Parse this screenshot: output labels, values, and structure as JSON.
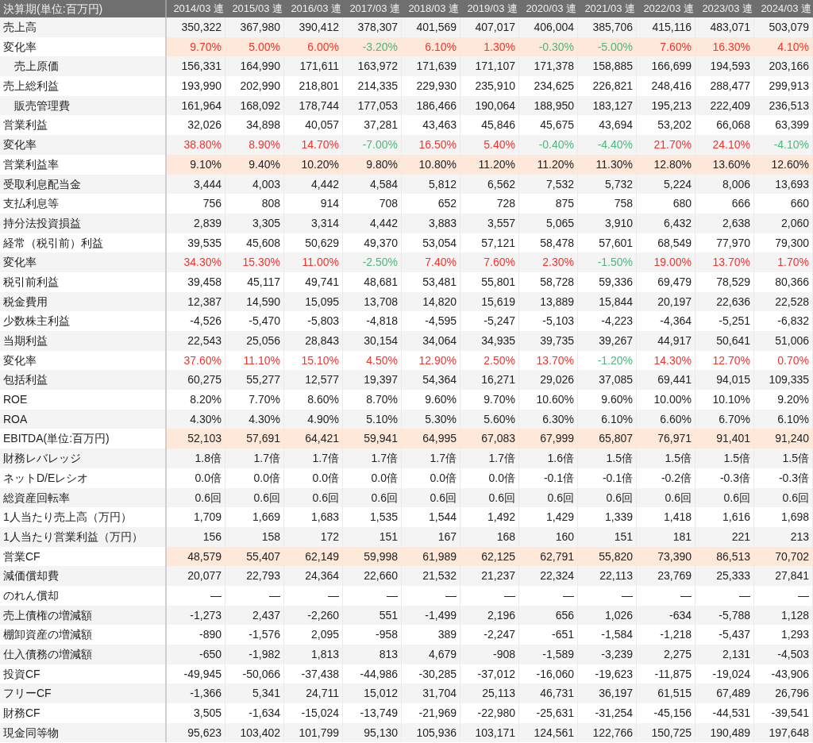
{
  "table": {
    "corner": "決算期(単位:百万円)",
    "columns": [
      "2014/03 連",
      "2015/03 連",
      "2016/03 連",
      "2017/03 連",
      "2018/03 連",
      "2019/03 連",
      "2020/03 連",
      "2021/03 連",
      "2022/03 連",
      "2023/03 連",
      "2024/03 連"
    ],
    "rows": [
      {
        "label": "売上高",
        "kind": "item",
        "highlighted": false,
        "cells": [
          "350,322",
          "367,980",
          "390,412",
          "378,307",
          "401,569",
          "407,017",
          "406,004",
          "385,706",
          "415,116",
          "483,071",
          "503,079"
        ]
      },
      {
        "label": "変化率",
        "kind": "rate",
        "highlighted": true,
        "cells": [
          {
            "text": "9.70%",
            "color": "#f5332b"
          },
          {
            "text": "5.00%",
            "color": "#f5332b"
          },
          {
            "text": "6.00%",
            "color": "#f5332b"
          },
          {
            "text": "-3.20%",
            "color": "#4cb87a"
          },
          {
            "text": "6.10%",
            "color": "#f5332b"
          },
          {
            "text": "1.30%",
            "color": "#f5332b"
          },
          {
            "text": "-0.30%",
            "color": "#4cb87a"
          },
          {
            "text": "-5.00%",
            "color": "#4cb87a"
          },
          {
            "text": "7.60%",
            "color": "#f5332b"
          },
          {
            "text": "16.30%",
            "color": "#f5332b"
          },
          {
            "text": "4.10%",
            "color": "#f5332b"
          }
        ]
      },
      {
        "label": "売上原価",
        "kind": "sub",
        "highlighted": false,
        "cells": [
          "156,331",
          "164,990",
          "171,611",
          "163,972",
          "171,639",
          "171,107",
          "171,378",
          "158,885",
          "166,699",
          "194,593",
          "203,166"
        ]
      },
      {
        "label": "売上総利益",
        "kind": "item",
        "highlighted": false,
        "cells": [
          "193,990",
          "202,990",
          "218,801",
          "214,335",
          "229,930",
          "235,910",
          "234,625",
          "226,821",
          "248,416",
          "288,477",
          "299,913"
        ]
      },
      {
        "label": "販売管理費",
        "kind": "sub",
        "highlighted": false,
        "cells": [
          "161,964",
          "168,092",
          "178,744",
          "177,053",
          "186,466",
          "190,064",
          "188,950",
          "183,127",
          "195,213",
          "222,409",
          "236,513"
        ]
      },
      {
        "label": "営業利益",
        "kind": "item",
        "highlighted": false,
        "cells": [
          "32,026",
          "34,898",
          "40,057",
          "37,281",
          "43,463",
          "45,846",
          "45,675",
          "43,694",
          "53,202",
          "66,068",
          "63,399"
        ]
      },
      {
        "label": "変化率",
        "kind": "rate",
        "highlighted": false,
        "cells": [
          {
            "text": "38.80%",
            "color": "#f5332b"
          },
          {
            "text": "8.90%",
            "color": "#f5332b"
          },
          {
            "text": "14.70%",
            "color": "#f5332b"
          },
          {
            "text": "-7.00%",
            "color": "#4cb87a"
          },
          {
            "text": "16.50%",
            "color": "#f5332b"
          },
          {
            "text": "5.40%",
            "color": "#f5332b"
          },
          {
            "text": "-0.40%",
            "color": "#4cb87a"
          },
          {
            "text": "-4.40%",
            "color": "#4cb87a"
          },
          {
            "text": "21.70%",
            "color": "#f5332b"
          },
          {
            "text": "24.10%",
            "color": "#f5332b"
          },
          {
            "text": "-4.10%",
            "color": "#4cb87a"
          }
        ]
      },
      {
        "label": "営業利益率",
        "kind": "item",
        "highlighted": true,
        "cells": [
          "9.10%",
          "9.40%",
          "10.20%",
          "9.80%",
          "10.80%",
          "11.20%",
          "11.20%",
          "11.30%",
          "12.80%",
          "13.60%",
          "12.60%"
        ]
      },
      {
        "label": "受取利息配当金",
        "kind": "item",
        "highlighted": false,
        "cells": [
          "3,444",
          "4,003",
          "4,442",
          "4,584",
          "5,812",
          "6,562",
          "7,532",
          "5,732",
          "5,224",
          "8,006",
          "13,693"
        ]
      },
      {
        "label": "支払利息等",
        "kind": "item",
        "highlighted": false,
        "cells": [
          "756",
          "808",
          "914",
          "708",
          "652",
          "728",
          "875",
          "758",
          "680",
          "666",
          "660"
        ]
      },
      {
        "label": "持分法投資損益",
        "kind": "item",
        "highlighted": false,
        "cells": [
          "2,839",
          "3,305",
          "3,314",
          "4,442",
          "3,883",
          "3,557",
          "5,065",
          "3,910",
          "6,432",
          "2,638",
          "2,060"
        ]
      },
      {
        "label": "経常（税引前）利益",
        "kind": "item",
        "highlighted": false,
        "cells": [
          "39,535",
          "45,608",
          "50,629",
          "49,370",
          "53,054",
          "57,121",
          "58,478",
          "57,601",
          "68,549",
          "77,970",
          "79,300"
        ]
      },
      {
        "label": "変化率",
        "kind": "rate",
        "highlighted": false,
        "cells": [
          {
            "text": "34.30%",
            "color": "#f5332b"
          },
          {
            "text": "15.30%",
            "color": "#f5332b"
          },
          {
            "text": "11.00%",
            "color": "#f5332b"
          },
          {
            "text": "-2.50%",
            "color": "#4cb87a"
          },
          {
            "text": "7.40%",
            "color": "#f5332b"
          },
          {
            "text": "7.60%",
            "color": "#f5332b"
          },
          {
            "text": "2.30%",
            "color": "#f5332b"
          },
          {
            "text": "-1.50%",
            "color": "#4cb87a"
          },
          {
            "text": "19.00%",
            "color": "#f5332b"
          },
          {
            "text": "13.70%",
            "color": "#f5332b"
          },
          {
            "text": "1.70%",
            "color": "#f5332b"
          }
        ]
      },
      {
        "label": "税引前利益",
        "kind": "item",
        "highlighted": false,
        "cells": [
          "39,458",
          "45,117",
          "49,741",
          "48,681",
          "53,481",
          "55,801",
          "58,728",
          "59,336",
          "69,479",
          "78,529",
          "80,366"
        ]
      },
      {
        "label": "税金費用",
        "kind": "item",
        "highlighted": false,
        "cells": [
          "12,387",
          "14,590",
          "15,095",
          "13,708",
          "14,820",
          "15,619",
          "13,889",
          "15,844",
          "20,197",
          "22,636",
          "22,528"
        ]
      },
      {
        "label": "少数株主利益",
        "kind": "item",
        "highlighted": false,
        "cells": [
          "-4,526",
          "-5,470",
          "-5,803",
          "-4,818",
          "-4,595",
          "-5,247",
          "-5,103",
          "-4,223",
          "-4,364",
          "-5,251",
          "-6,832"
        ]
      },
      {
        "label": "当期利益",
        "kind": "item",
        "highlighted": false,
        "cells": [
          "22,543",
          "25,056",
          "28,843",
          "30,154",
          "34,064",
          "34,935",
          "39,735",
          "39,267",
          "44,917",
          "50,641",
          "51,006"
        ]
      },
      {
        "label": "変化率",
        "kind": "rate",
        "highlighted": false,
        "cells": [
          {
            "text": "37.60%",
            "color": "#f5332b"
          },
          {
            "text": "11.10%",
            "color": "#f5332b"
          },
          {
            "text": "15.10%",
            "color": "#f5332b"
          },
          {
            "text": "4.50%",
            "color": "#f5332b"
          },
          {
            "text": "12.90%",
            "color": "#f5332b"
          },
          {
            "text": "2.50%",
            "color": "#f5332b"
          },
          {
            "text": "13.70%",
            "color": "#f5332b"
          },
          {
            "text": "-1.20%",
            "color": "#4cb87a"
          },
          {
            "text": "14.30%",
            "color": "#f5332b"
          },
          {
            "text": "12.70%",
            "color": "#f5332b"
          },
          {
            "text": "0.70%",
            "color": "#f5332b"
          }
        ]
      },
      {
        "label": "包括利益",
        "kind": "item",
        "highlighted": false,
        "cells": [
          "60,275",
          "55,277",
          "12,577",
          "19,397",
          "54,364",
          "16,271",
          "29,026",
          "37,085",
          "69,441",
          "94,015",
          "109,335"
        ]
      },
      {
        "label": "ROE",
        "kind": "item",
        "highlighted": false,
        "cells": [
          "8.20%",
          "7.70%",
          "8.60%",
          "8.70%",
          "9.60%",
          "9.70%",
          "10.60%",
          "9.60%",
          "10.00%",
          "10.10%",
          "9.20%"
        ]
      },
      {
        "label": "ROA",
        "kind": "item",
        "highlighted": false,
        "cells": [
          "4.30%",
          "4.30%",
          "4.90%",
          "5.10%",
          "5.30%",
          "5.60%",
          "6.30%",
          "6.10%",
          "6.60%",
          "6.70%",
          "6.10%"
        ]
      },
      {
        "label": "EBITDA(単位:百万円)",
        "kind": "item",
        "highlighted": true,
        "cells": [
          "52,103",
          "57,691",
          "64,421",
          "59,941",
          "64,995",
          "67,083",
          "67,999",
          "65,807",
          "76,971",
          "91,401",
          "91,240"
        ]
      },
      {
        "label": "財務レバレッジ",
        "kind": "item",
        "highlighted": false,
        "cells": [
          "1.8倍",
          "1.7倍",
          "1.7倍",
          "1.7倍",
          "1.7倍",
          "1.7倍",
          "1.6倍",
          "1.5倍",
          "1.5倍",
          "1.5倍",
          "1.5倍"
        ]
      },
      {
        "label": "ネットD/Eレシオ",
        "kind": "item",
        "highlighted": false,
        "cells": [
          "0.0倍",
          "0.0倍",
          "0.0倍",
          "0.0倍",
          "0.0倍",
          "0.0倍",
          "-0.1倍",
          "-0.1倍",
          "-0.2倍",
          "-0.3倍",
          "-0.3倍"
        ]
      },
      {
        "label": "総資産回転率",
        "kind": "item",
        "highlighted": false,
        "cells": [
          "0.6回",
          "0.6回",
          "0.6回",
          "0.6回",
          "0.6回",
          "0.6回",
          "0.6回",
          "0.6回",
          "0.6回",
          "0.6回",
          "0.6回"
        ]
      },
      {
        "label": "1人当たり売上高（万円）",
        "kind": "item",
        "highlighted": false,
        "cells": [
          "1,709",
          "1,669",
          "1,683",
          "1,535",
          "1,544",
          "1,492",
          "1,429",
          "1,339",
          "1,418",
          "1,616",
          "1,698"
        ]
      },
      {
        "label": "1人当たり営業利益（万円）",
        "kind": "item",
        "highlighted": false,
        "cells": [
          "156",
          "158",
          "172",
          "151",
          "167",
          "168",
          "160",
          "151",
          "181",
          "221",
          "213"
        ]
      },
      {
        "label": "営業CF",
        "kind": "item",
        "highlighted": true,
        "cells": [
          "48,579",
          "55,407",
          "62,149",
          "59,998",
          "61,989",
          "62,125",
          "62,791",
          "55,820",
          "73,390",
          "86,513",
          "70,702"
        ]
      },
      {
        "label": "減価償却費",
        "kind": "item",
        "highlighted": false,
        "cells": [
          "20,077",
          "22,793",
          "24,364",
          "22,660",
          "21,532",
          "21,237",
          "22,324",
          "22,113",
          "23,769",
          "25,333",
          "27,841"
        ]
      },
      {
        "label": "のれん償却",
        "kind": "item",
        "highlighted": false,
        "cells": [
          "—",
          "—",
          "—",
          "—",
          "—",
          "—",
          "—",
          "—",
          "—",
          "—",
          "—"
        ]
      },
      {
        "label": "売上債権の増減額",
        "kind": "item",
        "highlighted": false,
        "cells": [
          "-1,273",
          "2,437",
          "-2,260",
          "551",
          "-1,499",
          "2,196",
          "656",
          "1,026",
          "-634",
          "-5,788",
          "1,128"
        ]
      },
      {
        "label": "棚卸資産の増減額",
        "kind": "item",
        "highlighted": false,
        "cells": [
          "-890",
          "-1,576",
          "2,095",
          "-958",
          "389",
          "-2,247",
          "-651",
          "-1,584",
          "-1,218",
          "-5,437",
          "1,293"
        ]
      },
      {
        "label": "仕入債務の増減額",
        "kind": "item",
        "highlighted": false,
        "cells": [
          "-650",
          "-1,982",
          "1,813",
          "813",
          "4,679",
          "-908",
          "-1,589",
          "-3,239",
          "2,275",
          "2,131",
          "-4,503"
        ]
      },
      {
        "label": "投資CF",
        "kind": "item",
        "highlighted": false,
        "cells": [
          "-49,945",
          "-50,066",
          "-37,438",
          "-44,986",
          "-30,285",
          "-37,012",
          "-16,060",
          "-19,623",
          "-11,875",
          "-19,024",
          "-43,906"
        ]
      },
      {
        "label": "フリーCF",
        "kind": "item",
        "highlighted": false,
        "cells": [
          "-1,366",
          "5,341",
          "24,711",
          "15,012",
          "31,704",
          "25,113",
          "46,731",
          "36,197",
          "61,515",
          "67,489",
          "26,796"
        ]
      },
      {
        "label": "財務CF",
        "kind": "item",
        "highlighted": false,
        "cells": [
          "3,505",
          "-1,634",
          "-15,024",
          "-13,749",
          "-21,969",
          "-22,980",
          "-25,631",
          "-31,254",
          "-45,156",
          "-44,531",
          "-39,541"
        ]
      },
      {
        "label": "現金同等物",
        "kind": "item",
        "highlighted": false,
        "cells": [
          "95,623",
          "103,402",
          "101,799",
          "95,130",
          "105,936",
          "103,171",
          "124,561",
          "122,766",
          "150,725",
          "190,489",
          "197,648"
        ]
      }
    ]
  }
}
